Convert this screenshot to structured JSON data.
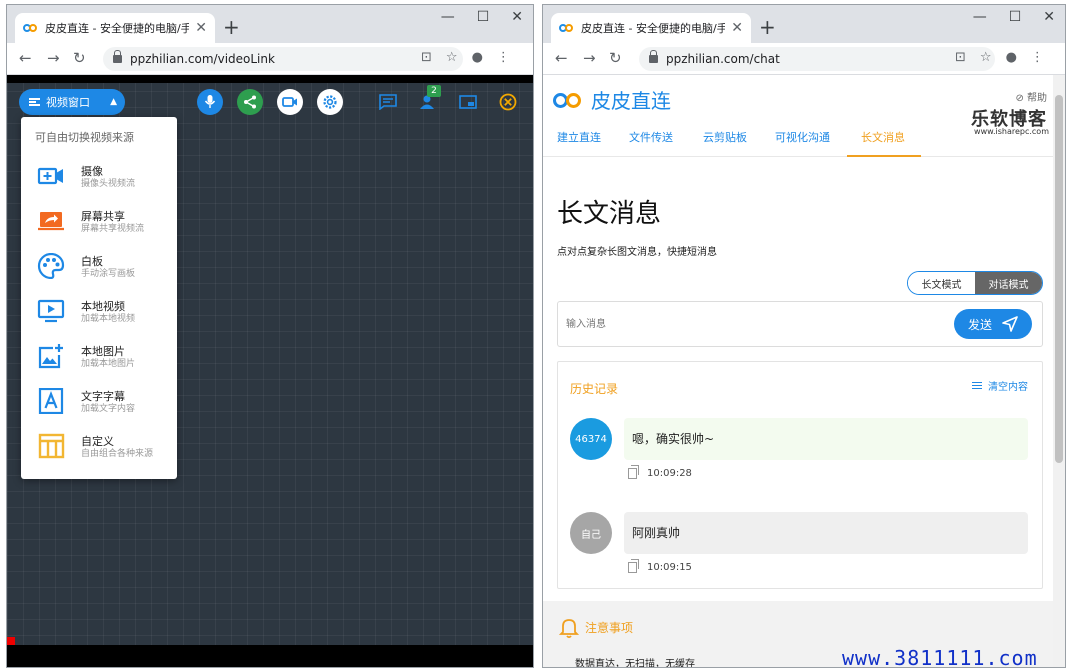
{
  "left_window": {
    "tab_title": "皮皮直连 - 安全便捷的电脑/手机",
    "url": "ppzhilian.com/videoLink",
    "page": {
      "video_window_button": "视频窗口",
      "participant_badge": "2",
      "source_menu": {
        "header": "可自由切换视频来源",
        "items": [
          {
            "name": "摄像",
            "desc": "摄像头视频流",
            "icon": "camera-icon"
          },
          {
            "name": "屏幕共享",
            "desc": "屏幕共享视频流",
            "icon": "screen-share-icon"
          },
          {
            "name": "白板",
            "desc": "手动涂写画板",
            "icon": "palette-icon"
          },
          {
            "name": "本地视频",
            "desc": "加载本地视频",
            "icon": "local-video-icon"
          },
          {
            "name": "本地图片",
            "desc": "加载本地图片",
            "icon": "add-image-icon"
          },
          {
            "name": "文字字幕",
            "desc": "加载文字内容",
            "icon": "text-caption-icon"
          },
          {
            "name": "自定义",
            "desc": "自由组合各种来源",
            "icon": "custom-layout-icon"
          }
        ]
      }
    }
  },
  "right_window": {
    "tab_title": "皮皮直连 - 安全便捷的电脑/手机",
    "url": "ppzhilian.com/chat",
    "page": {
      "brand": "皮皮直连",
      "help": "帮助",
      "watermark_title": "乐软博客",
      "watermark_url": "www.isharepc.com",
      "nav_tabs": [
        "建立直连",
        "文件传送",
        "云剪贴板",
        "可视化沟通",
        "长文消息"
      ],
      "active_tab": "长文消息",
      "heading": "长文消息",
      "subheading": "点对点复杂长图文消息，快捷短消息",
      "mode_toggle": {
        "long": "长文模式",
        "chat": "对话模式",
        "selected": "对话模式"
      },
      "input_placeholder": "输入消息",
      "send_label": "发送",
      "history": {
        "title": "历史记录",
        "clear_label": "清空内容",
        "messages": [
          {
            "avatar": "46374",
            "text": "嗯，确实很帅~",
            "time": "10:09:28",
            "avatar_color": "#1a9be0",
            "bubble_color": "#f3fbef"
          },
          {
            "avatar": "自己",
            "text": "阿刚真帅",
            "time": "10:09:15",
            "avatar_color": "#a6a6a6",
            "bubble_color": "#efefef"
          }
        ]
      },
      "notice": {
        "title": "注意事项",
        "body": "数据直达，无扫描，无缓存"
      }
    }
  },
  "site_watermark": "www.3811111.com",
  "colors": {
    "accent": "#1e88e5",
    "orange": "#f0a020"
  }
}
